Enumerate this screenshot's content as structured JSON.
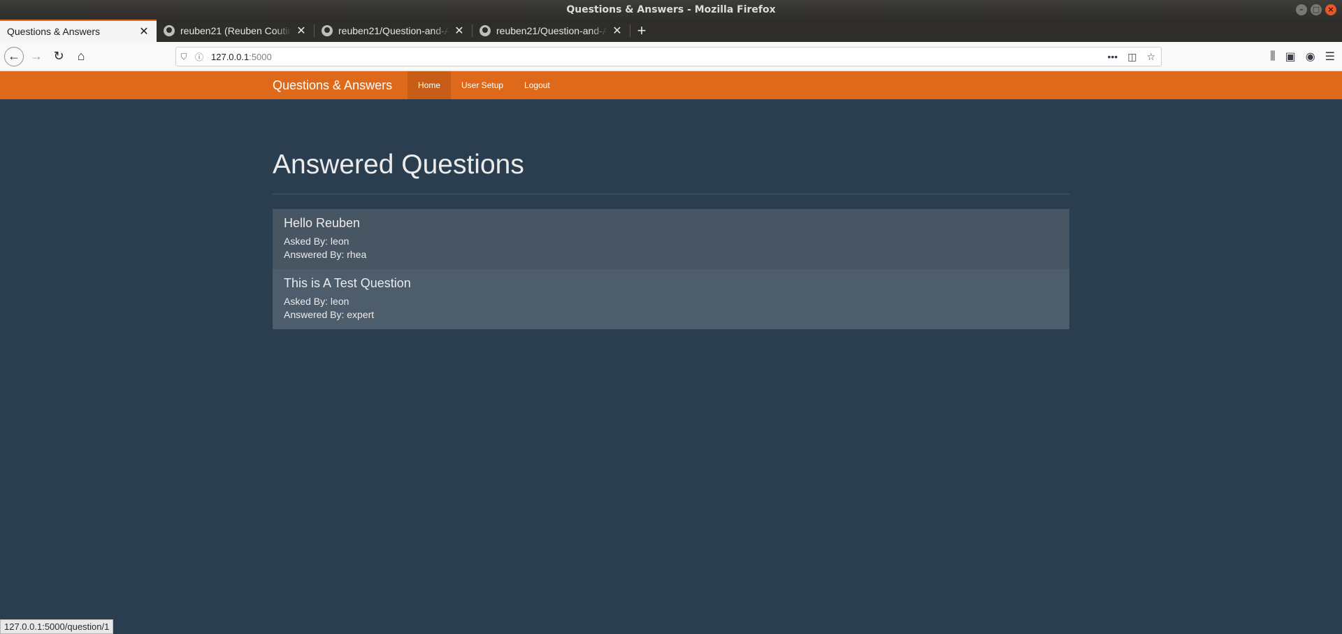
{
  "window": {
    "title": "Questions & Answers - Mozilla Firefox"
  },
  "tabs": [
    {
      "label": "Questions & Answers",
      "active": true
    },
    {
      "label": "reuben21 (Reuben Coutinho)",
      "active": false
    },
    {
      "label": "reuben21/Question-and-Answer",
      "active": false
    },
    {
      "label": "reuben21/Question-and-Answer",
      "active": false
    }
  ],
  "urlbar": {
    "host": "127.0.0.1",
    "port": ":5000"
  },
  "site": {
    "brand": "Questions & Answers",
    "nav": [
      "Home",
      "User Setup",
      "Logout"
    ],
    "accent": "#df691a",
    "background": "#2b3e50"
  },
  "page": {
    "heading": "Answered Questions",
    "questions": [
      {
        "title": "Hello Reuben",
        "asked": "Asked By: leon",
        "answered": "Answered By: rhea"
      },
      {
        "title": "This is A Test Question",
        "asked": "Asked By: leon",
        "answered": "Answered By: expert"
      }
    ]
  },
  "status": {
    "url": "127.0.0.1:5000/question/1"
  }
}
